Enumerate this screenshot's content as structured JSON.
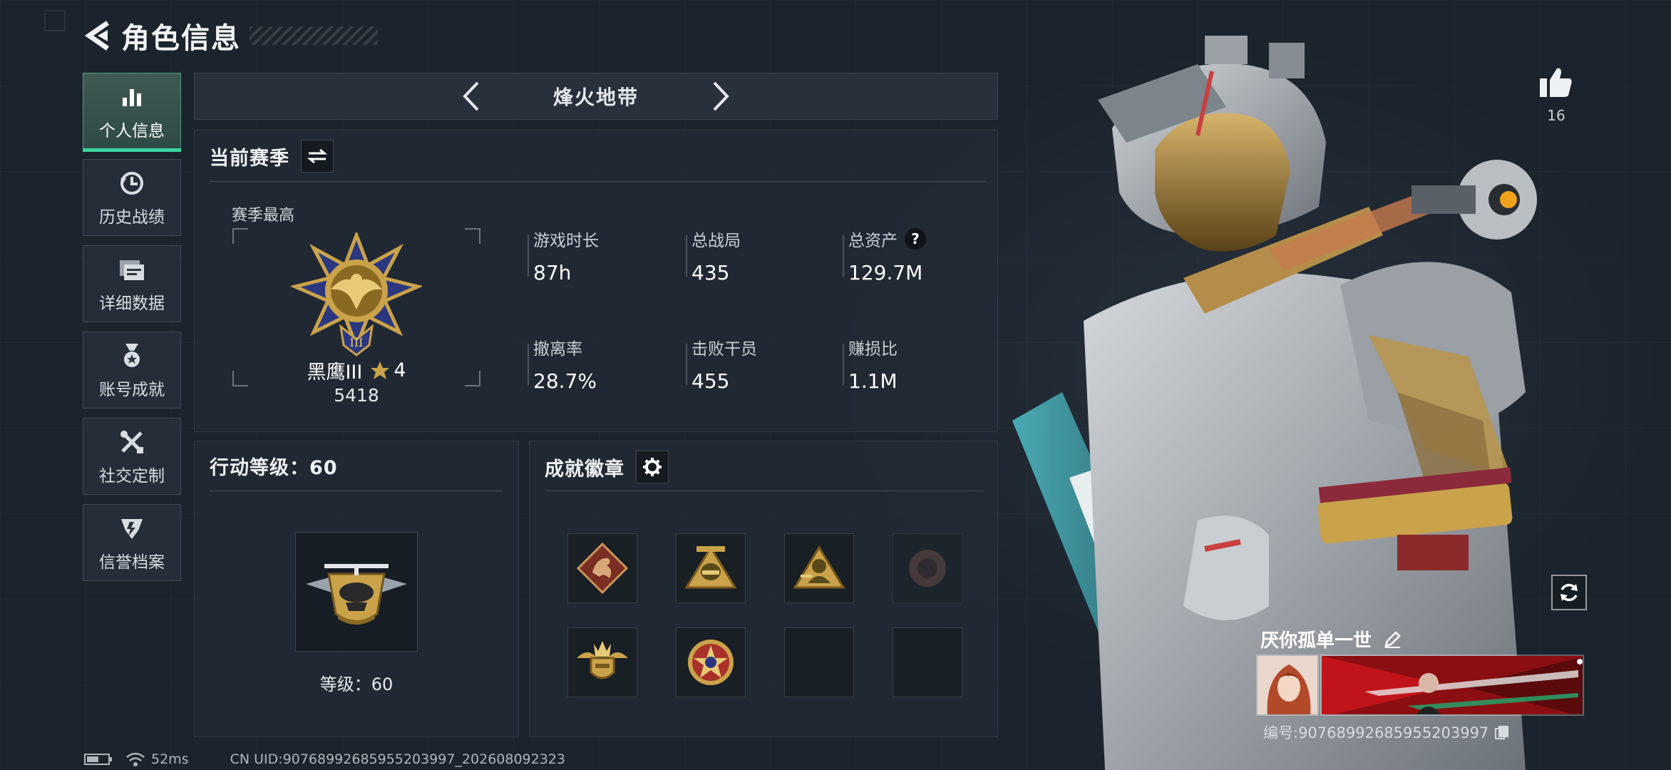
{
  "header": {
    "title": "角色信息"
  },
  "sidebar": {
    "items": [
      {
        "label": "个人信息",
        "icon": "bar-chart-icon",
        "active": true
      },
      {
        "label": "历史战绩",
        "icon": "clock-history-icon"
      },
      {
        "label": "详细数据",
        "icon": "folder-data-icon"
      },
      {
        "label": "账号成就",
        "icon": "medal-icon"
      },
      {
        "label": "社交定制",
        "icon": "tools-icon"
      },
      {
        "label": "信誉档案",
        "icon": "shield-badge-icon"
      }
    ]
  },
  "mode": {
    "title": "烽火地带"
  },
  "season": {
    "title": "当前赛季",
    "best_label": "赛季最高",
    "rank_name": "黑鹰III",
    "rank_stars": "4",
    "rank_score": "5418"
  },
  "stats": [
    {
      "label": "游戏时长",
      "value": "87h"
    },
    {
      "label": "总战局",
      "value": "435"
    },
    {
      "label": "总资产",
      "value": "129.7M",
      "help": "?"
    },
    {
      "label": "撤离率",
      "value": "28.7%"
    },
    {
      "label": "击败干员",
      "value": "455"
    },
    {
      "label": "赚损比",
      "value": "1.1M"
    }
  ],
  "level": {
    "title": "行动等级：60",
    "caption": "等级：60"
  },
  "badges": {
    "title": "成就徽章",
    "slots": [
      {
        "icon": "dragon-badge-icon",
        "filled": true
      },
      {
        "icon": "helmet-badge-icon",
        "filled": true
      },
      {
        "icon": "soldier-badge-icon",
        "filled": true
      },
      {
        "icon": "locked-badge-icon",
        "filled": true
      },
      {
        "icon": "wings-crown-badge-icon",
        "filled": true
      },
      {
        "icon": "star-medal-badge-icon",
        "filled": true
      },
      {
        "icon": "empty-slot",
        "filled": false
      },
      {
        "icon": "empty-slot",
        "filled": false
      }
    ]
  },
  "profile": {
    "likes": "16",
    "player_name": "厌你孤单一世",
    "player_id": "编号:9076899268595520399​7"
  },
  "statusbar": {
    "ping": "52ms",
    "uid": "CN UID:9076899268595520399​7_202608092323"
  },
  "colors": {
    "accent": "#39d6a0",
    "gold": "#c9a24a",
    "background": "#1b232c"
  }
}
